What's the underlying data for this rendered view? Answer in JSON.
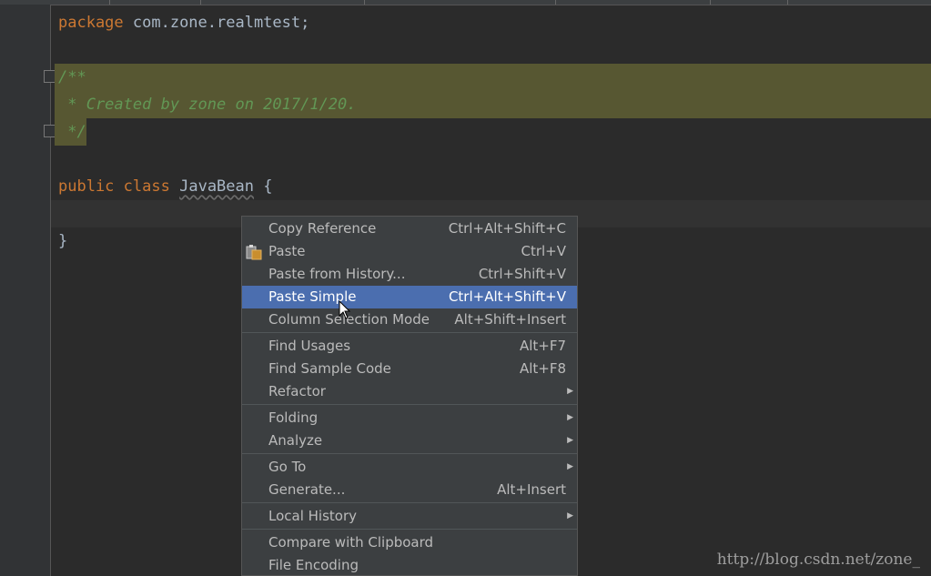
{
  "editor": {
    "package_kw": "package",
    "package_name": " com.zone.realmtest;",
    "doc_open": "/**",
    "doc_body": " * Created by zone on 2017/1/20.",
    "doc_close": " */",
    "public_kw": "public",
    "class_kw": "class",
    "class_name": "JavaBean",
    "open_brace": "{",
    "close_brace": "}"
  },
  "context_menu": {
    "items": [
      {
        "label": "Copy Reference",
        "shortcut": "Ctrl+Alt+Shift+C"
      },
      {
        "label": "Paste",
        "shortcut": "Ctrl+V",
        "icon": "clipboard-icon"
      },
      {
        "label": "Paste from History...",
        "shortcut": "Ctrl+Shift+V"
      },
      {
        "label": "Paste Simple",
        "shortcut": "Ctrl+Alt+Shift+V",
        "selected": true
      },
      {
        "label": "Column Selection Mode",
        "shortcut": "Alt+Shift+Insert"
      },
      {
        "label": "Find Usages",
        "shortcut": "Alt+F7"
      },
      {
        "label": "Find Sample Code",
        "shortcut": "Alt+F8"
      },
      {
        "label": "Refactor",
        "submenu": true
      },
      {
        "label": "Folding",
        "submenu": true
      },
      {
        "label": "Analyze",
        "submenu": true
      },
      {
        "label": "Go To",
        "submenu": true
      },
      {
        "label": "Generate...",
        "shortcut": "Alt+Insert"
      },
      {
        "label": "Local History",
        "submenu": true
      },
      {
        "label": "Compare with Clipboard"
      },
      {
        "label": "File Encoding"
      }
    ]
  },
  "watermark": "http://blog.csdn.net/zone_",
  "colors": {
    "editor_bg": "#2b2b2b",
    "keyword": "#cc7832",
    "comment": "#629755",
    "doc_highlight": "#575732",
    "menu_bg": "#3c3f41",
    "menu_selected": "#4b6eaf"
  }
}
